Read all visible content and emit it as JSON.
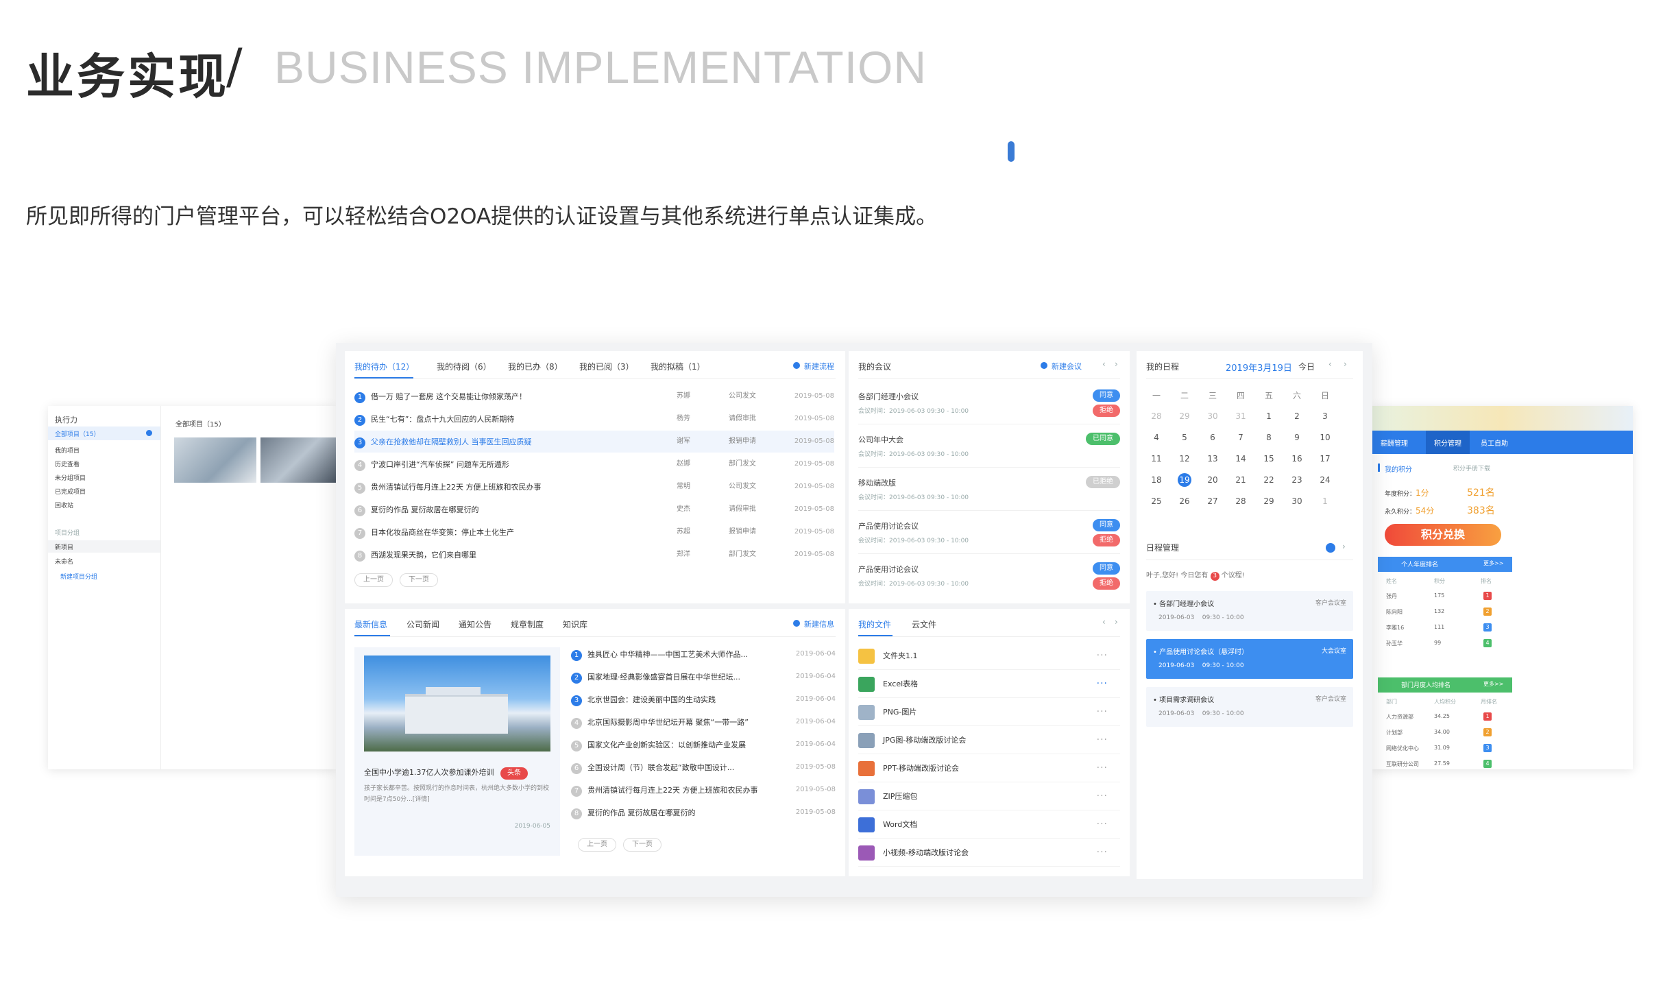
{
  "header": {
    "title_cn": "业务实现",
    "slash": "/",
    "title_en": "BUSINESS IMPLEMENTATION",
    "subtitle": "所见即所得的门户管理平台，可以轻松结合O2OA提供的认证设置与其他系统进行单点认证集成。"
  },
  "left_panel": {
    "title": "执行力",
    "all_projects": "全部项目（15）",
    "items": [
      "我的项目",
      "历史查看",
      "未分组项目",
      "已完成项目",
      "回收站"
    ],
    "group_label": "项目分组",
    "group_items": [
      "新项目",
      "未命名"
    ],
    "new_group": "新建项目分组",
    "grid_title": "全部项目（15）"
  },
  "todo": {
    "tabs": [
      "我的待办（12）",
      "我的待阅（6）",
      "我的已办（8）",
      "我的已阅（3）",
      "我的拟稿（1）"
    ],
    "new_btn": "新建流程",
    "rows": [
      {
        "n": "1",
        "title": "借一万 赔了一套房 这个交易能让你倾家荡产！",
        "person": "苏娜",
        "type": "公司发文",
        "date": "2019-05-08"
      },
      {
        "n": "2",
        "title": "民生“七有”：盘点十九大回应的人民新期待",
        "person": "杨芳",
        "type": "请假审批",
        "date": "2019-05-08"
      },
      {
        "n": "3",
        "title": "父亲在抢救他却在隔壁救别人 当事医生回应质疑",
        "person": "谢军",
        "type": "报销申请",
        "date": "2019-05-08"
      },
      {
        "n": "4",
        "title": "宁波口岸引进“汽车侦探” 问题车无所遁形",
        "person": "赵娜",
        "type": "部门发文",
        "date": "2019-05-08"
      },
      {
        "n": "5",
        "title": "贵州清镇试行每月连上22天 方便上班族和农民办事",
        "person": "常明",
        "type": "公司发文",
        "date": "2019-05-08"
      },
      {
        "n": "6",
        "title": "夏衍的作品 夏衍故居在哪夏衍的",
        "person": "史杰",
        "type": "请假审批",
        "date": "2019-05-08"
      },
      {
        "n": "7",
        "title": "日本化妆品商丝在华变策：停止本土化生产",
        "person": "苏超",
        "type": "报销申请",
        "date": "2019-05-08"
      },
      {
        "n": "8",
        "title": "西湖发现果天鹅，它们来自哪里",
        "person": "郑洋",
        "type": "部门发文",
        "date": "2019-05-08"
      }
    ],
    "prev": "上一页",
    "next": "下一页"
  },
  "meetings": {
    "title": "我的会议",
    "new_btn": "新建会议",
    "time_label": "会议时间：",
    "items": [
      {
        "name": "各部门经理小会议",
        "time": "2019-06-03  09:30 - 10:00",
        "tags": [
          {
            "t": "同意",
            "c": "#3d8ef0"
          },
          {
            "t": "拒绝",
            "c": "#f26a6a"
          }
        ]
      },
      {
        "name": "公司年中大会",
        "time": "2019-06-03  09:30 - 10:00",
        "tags": [
          {
            "t": "已同意",
            "c": "#4cbf6b"
          }
        ]
      },
      {
        "name": "移动端改版",
        "time": "2019-06-03  09:30 - 10:00",
        "tags": [
          {
            "t": "已拒绝",
            "c": "#cfcfcf"
          }
        ]
      },
      {
        "name": "产品使用讨论会议",
        "time": "2019-06-03  09:30 - 10:00",
        "tags": [
          {
            "t": "同意",
            "c": "#3d8ef0"
          },
          {
            "t": "拒绝",
            "c": "#f26a6a"
          }
        ]
      },
      {
        "name": "产品使用讨论会议",
        "time": "2019-06-03  09:30 - 10:00",
        "tags": [
          {
            "t": "同意",
            "c": "#3d8ef0"
          },
          {
            "t": "拒绝",
            "c": "#f26a6a"
          }
        ]
      }
    ]
  },
  "schedule": {
    "title": "我的日程",
    "date": "2019年3月19日",
    "today": "今日",
    "weekdays": [
      "一",
      "二",
      "三",
      "四",
      "五",
      "六",
      "日"
    ],
    "weeks": [
      [
        "28",
        "29",
        "30",
        "31",
        "1",
        "2",
        "3"
      ],
      [
        "4",
        "5",
        "6",
        "7",
        "8",
        "9",
        "10"
      ],
      [
        "11",
        "12",
        "13",
        "14",
        "15",
        "16",
        "17"
      ],
      [
        "18",
        "19",
        "20",
        "21",
        "22",
        "23",
        "24"
      ],
      [
        "25",
        "26",
        "27",
        "28",
        "29",
        "30",
        "1"
      ]
    ],
    "selected": "19",
    "manage_title": "日程管理",
    "greeting": "叶子,您好! 今日您有",
    "greeting_count": "3",
    "greeting_tail": "个议程!",
    "events": [
      {
        "name": "• 各部门经理小会议",
        "room": "客户会议室",
        "time": "2019-06-03    09:30 - 10:00"
      },
      {
        "name": "• 产品使用讨论会议（悬浮时）",
        "room": "大会议室",
        "time": "2019-06-03    09:30 - 10:00"
      },
      {
        "name": "• 项目需求调研会议",
        "room": "客户会议室",
        "time": "2019-06-03    09:30 - 10:00"
      }
    ]
  },
  "news": {
    "tabs": [
      "最新信息",
      "公司新闻",
      "通知公告",
      "规章制度",
      "知识库"
    ],
    "new_btn": "新建信息",
    "feature_title": "全国中小学逾1.37亿人次参加课外培训",
    "feature_badge": "头条",
    "feature_desc": "孩子家长都辛苦。按照现行的作息时间表，杭州绝大多数小学的到校时间是7点50分...[详情]",
    "feature_date": "2019-06-05",
    "rows": [
      {
        "n": "1",
        "title": "独具匠心 中华精神——中国工艺美术大师作品...",
        "date": "2019-06-04"
      },
      {
        "n": "2",
        "title": "国家地理·经典影像盛宴首日展在中华世纪坛...",
        "date": "2019-06-04"
      },
      {
        "n": "3",
        "title": "北京世园会：建设美丽中国的生动实践",
        "date": "2019-06-04"
      },
      {
        "n": "4",
        "title": "北京国际摄影周中华世纪坛开幕 聚焦“一带一路”",
        "date": "2019-06-04"
      },
      {
        "n": "5",
        "title": "国家文化产业创新实验区：以创新推动产业发展",
        "date": "2019-06-04"
      },
      {
        "n": "6",
        "title": "全国设计周（节）联合发起“致敬中国设计...",
        "date": "2019-05-08"
      },
      {
        "n": "7",
        "title": "贵州清镇试行每月连上22天 方便上班族和农民办事",
        "date": "2019-05-08"
      },
      {
        "n": "8",
        "title": "夏衍的作品 夏衍故居在哪夏衍的",
        "date": "2019-05-08"
      }
    ],
    "prev": "上一页",
    "next": "下一页"
  },
  "files": {
    "tabs": [
      "我的文件",
      "云文件"
    ],
    "items": [
      {
        "name": "文件夹1.1",
        "color": "#f5c242"
      },
      {
        "name": "Excel表格",
        "color": "#3aa55d"
      },
      {
        "name": "PNG-图片",
        "color": "#9fb3c8"
      },
      {
        "name": "JPG图-移动端改版讨论会",
        "color": "#8aa0b8"
      },
      {
        "name": "PPT-移动端改版讨论会",
        "color": "#e8703a"
      },
      {
        "name": "ZIP压缩包",
        "color": "#7a8fd8"
      },
      {
        "name": "Word文档",
        "color": "#3d6fd8"
      },
      {
        "name": "小视频-移动端改版讨论会",
        "color": "#9b59b6"
      }
    ]
  },
  "points": {
    "tabs": [
      "薪酬管理",
      "积分管理",
      "员工自助"
    ],
    "my_points": "我的积分",
    "download": "积分手册下载",
    "year_label": "年度积分：",
    "year_val": "1分",
    "year_rank": "521名",
    "total_label": "永久积分：",
    "total_val": "54分",
    "total_rank": "383名",
    "exchange": "积分兑换",
    "personal_title": "个人年度排名",
    "more": "更多>>",
    "personal_head": [
      "姓名",
      "积分",
      "排名"
    ],
    "personal_rows": [
      {
        "name": "张丹",
        "score": "175",
        "rank": "1",
        "c": "#e84a4a"
      },
      {
        "name": "陈向阳",
        "score": "132",
        "rank": "2",
        "c": "#f0a030"
      },
      {
        "name": "李雅16",
        "score": "111",
        "rank": "3",
        "c": "#3d8ef0"
      },
      {
        "name": "孙玉华",
        "score": "99",
        "rank": "4",
        "c": "#4cbf6b"
      }
    ],
    "dept_title": "部门月度人均排名",
    "dept_head": [
      "部门",
      "人均积分",
      "月排名"
    ],
    "dept_rows": [
      {
        "name": "人力资源部",
        "score": "34.25",
        "rank": "1",
        "c": "#e84a4a"
      },
      {
        "name": "计划部",
        "score": "34.00",
        "rank": "2",
        "c": "#f0a030"
      },
      {
        "name": "网络优化中心",
        "score": "31.09",
        "rank": "3",
        "c": "#3d8ef0"
      },
      {
        "name": "互联研分公司",
        "score": "27.59",
        "rank": "4",
        "c": "#4cbf6b"
      }
    ]
  }
}
